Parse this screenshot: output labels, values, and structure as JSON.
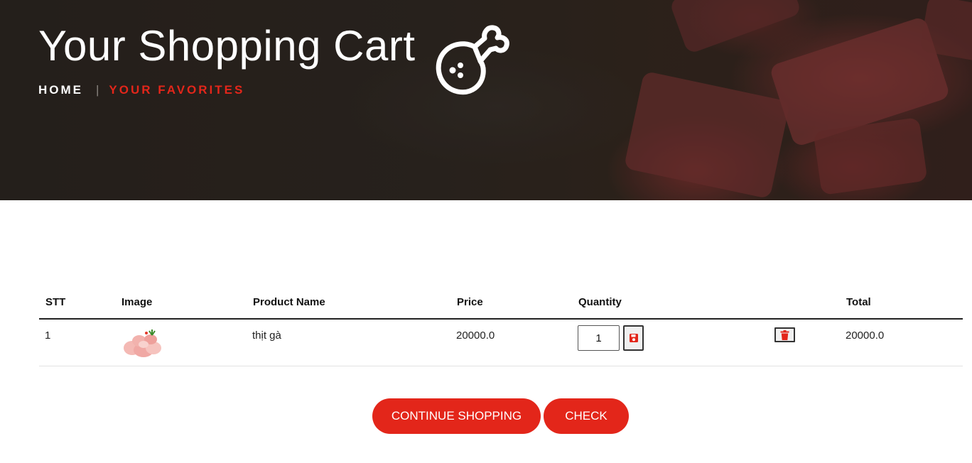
{
  "header": {
    "title": "Your Shopping Cart",
    "icon": "drumstick-icon",
    "breadcrumb": {
      "home": "HOME",
      "separator": "|",
      "current": "YOUR FAVORITES"
    }
  },
  "cart": {
    "columns": [
      "STT",
      "Image",
      "Product Name",
      "Price",
      "Quantity",
      "",
      "Total"
    ],
    "rows": [
      {
        "stt": "1",
        "image": "chicken-product-image",
        "name": "thịt gà",
        "price": "20000.0",
        "quantity": "1",
        "total": "20000.0"
      }
    ]
  },
  "actions": {
    "continue_label": "CONTINUE SHOPPING",
    "check_label": "CHECK"
  },
  "colors": {
    "accent": "#e3261a",
    "hero_dark": "#2a2420",
    "text": "#222222"
  }
}
